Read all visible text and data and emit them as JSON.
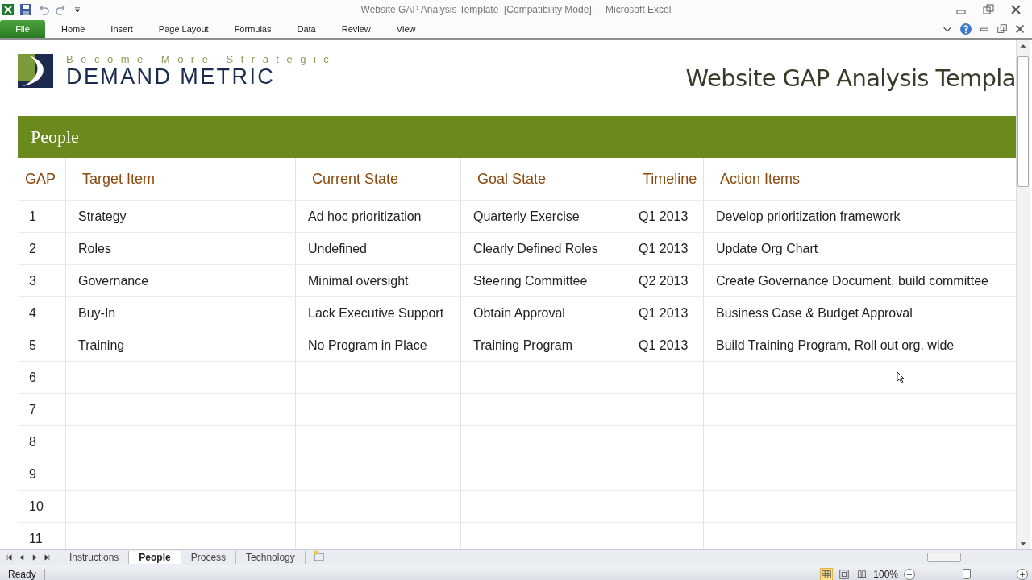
{
  "window": {
    "title": "Website GAP Analysis Template  [Compatibility Mode]  -  Microsoft Excel"
  },
  "ribbon_tabs": [
    {
      "label": "File",
      "kind": "file"
    },
    {
      "label": "Home",
      "kind": "tab"
    },
    {
      "label": "Insert",
      "kind": "tab"
    },
    {
      "label": "Page Layout",
      "kind": "tab"
    },
    {
      "label": "Formulas",
      "kind": "tab"
    },
    {
      "label": "Data",
      "kind": "tab"
    },
    {
      "label": "Review",
      "kind": "tab"
    },
    {
      "label": "View",
      "kind": "tab"
    }
  ],
  "logo": {
    "tagline": "Become More Strategic",
    "name": "DEMAND METRIC"
  },
  "sheet_title": "Website GAP Analysis Templa",
  "section": "People",
  "table": {
    "columns": [
      "GAP",
      "Target Item",
      "Current State",
      "Goal State",
      "Timeline",
      "Action Items"
    ],
    "rows": [
      [
        "1",
        "Strategy",
        "Ad hoc prioritization",
        "Quarterly Exercise",
        "Q1 2013",
        "Develop prioritization framework"
      ],
      [
        "2",
        "Roles",
        "Undefined",
        "Clearly Defined Roles",
        "Q1 2013",
        "Update Org Chart"
      ],
      [
        "3",
        "Governance",
        "Minimal oversight",
        "Steering Committee",
        "Q2 2013",
        "Create Governance Document, build committee"
      ],
      [
        "4",
        "Buy-In",
        "Lack Executive Support",
        "Obtain Approval",
        "Q1 2013",
        "Business Case & Budget Approval"
      ],
      [
        "5",
        "Training",
        "No Program in Place",
        "Training Program",
        "Q1 2013",
        "Build Training Program, Roll out org. wide"
      ],
      [
        "6",
        "",
        "",
        "",
        "",
        ""
      ],
      [
        "7",
        "",
        "",
        "",
        "",
        ""
      ],
      [
        "8",
        "",
        "",
        "",
        "",
        ""
      ],
      [
        "9",
        "",
        "",
        "",
        "",
        ""
      ],
      [
        "10",
        "",
        "",
        "",
        "",
        ""
      ],
      [
        "11",
        "",
        "",
        "",
        "",
        ""
      ]
    ]
  },
  "sheet_tabs": [
    {
      "label": "Instructions",
      "selected": false
    },
    {
      "label": "People",
      "selected": true
    },
    {
      "label": "Process",
      "selected": false
    },
    {
      "label": "Technology",
      "selected": false
    }
  ],
  "status_bar": {
    "status": "Ready",
    "views": [
      {
        "kind": "normal",
        "selected": true
      },
      {
        "kind": "layout",
        "selected": false
      },
      {
        "kind": "break",
        "selected": false
      }
    ],
    "zoom": "100%",
    "zoom_slider": {
      "level": 0.5
    }
  }
}
